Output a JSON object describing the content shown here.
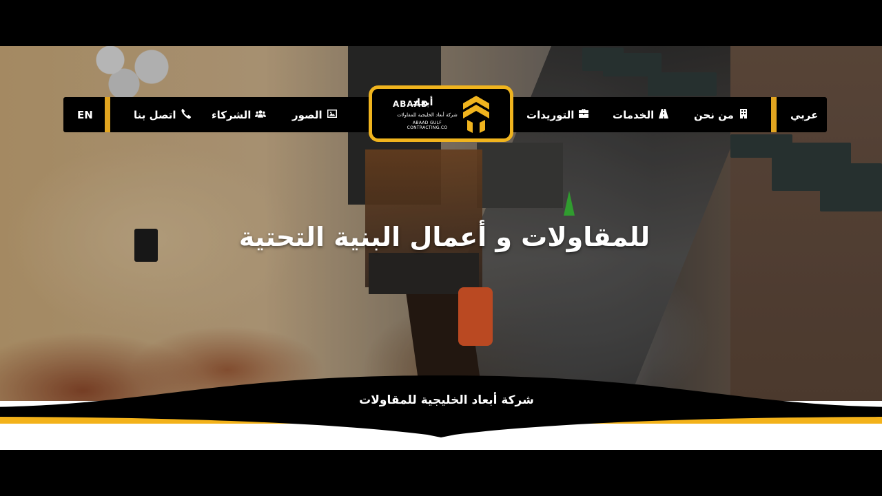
{
  "nav": {
    "lang_ar": "عربي",
    "about": "من نحن",
    "services": "الخدمات",
    "supplies": "التوريدات",
    "gallery": "الصور",
    "partners": "الشركاء",
    "contact": "اتصل بنا",
    "lang_en": "EN"
  },
  "logo": {
    "arabic_name": "أبعاد",
    "english_name": "ABAAD",
    "arabic_sub": "شركة أبعاد الخليجية للمقاولات",
    "english_sub": "ABAAD GULF CONTRACTING.CO"
  },
  "hero": {
    "headline": "للمقاولات و أعمال البنية التحتية",
    "tagline": "شركة أبعاد الخليجية للمقاولات"
  },
  "colors": {
    "accent": "#f3b21a",
    "bar": "#000000",
    "text": "#ffffff"
  },
  "icons": [
    "building-icon",
    "road-icon",
    "briefcase-icon",
    "image-icon",
    "users-icon",
    "phone-icon"
  ]
}
